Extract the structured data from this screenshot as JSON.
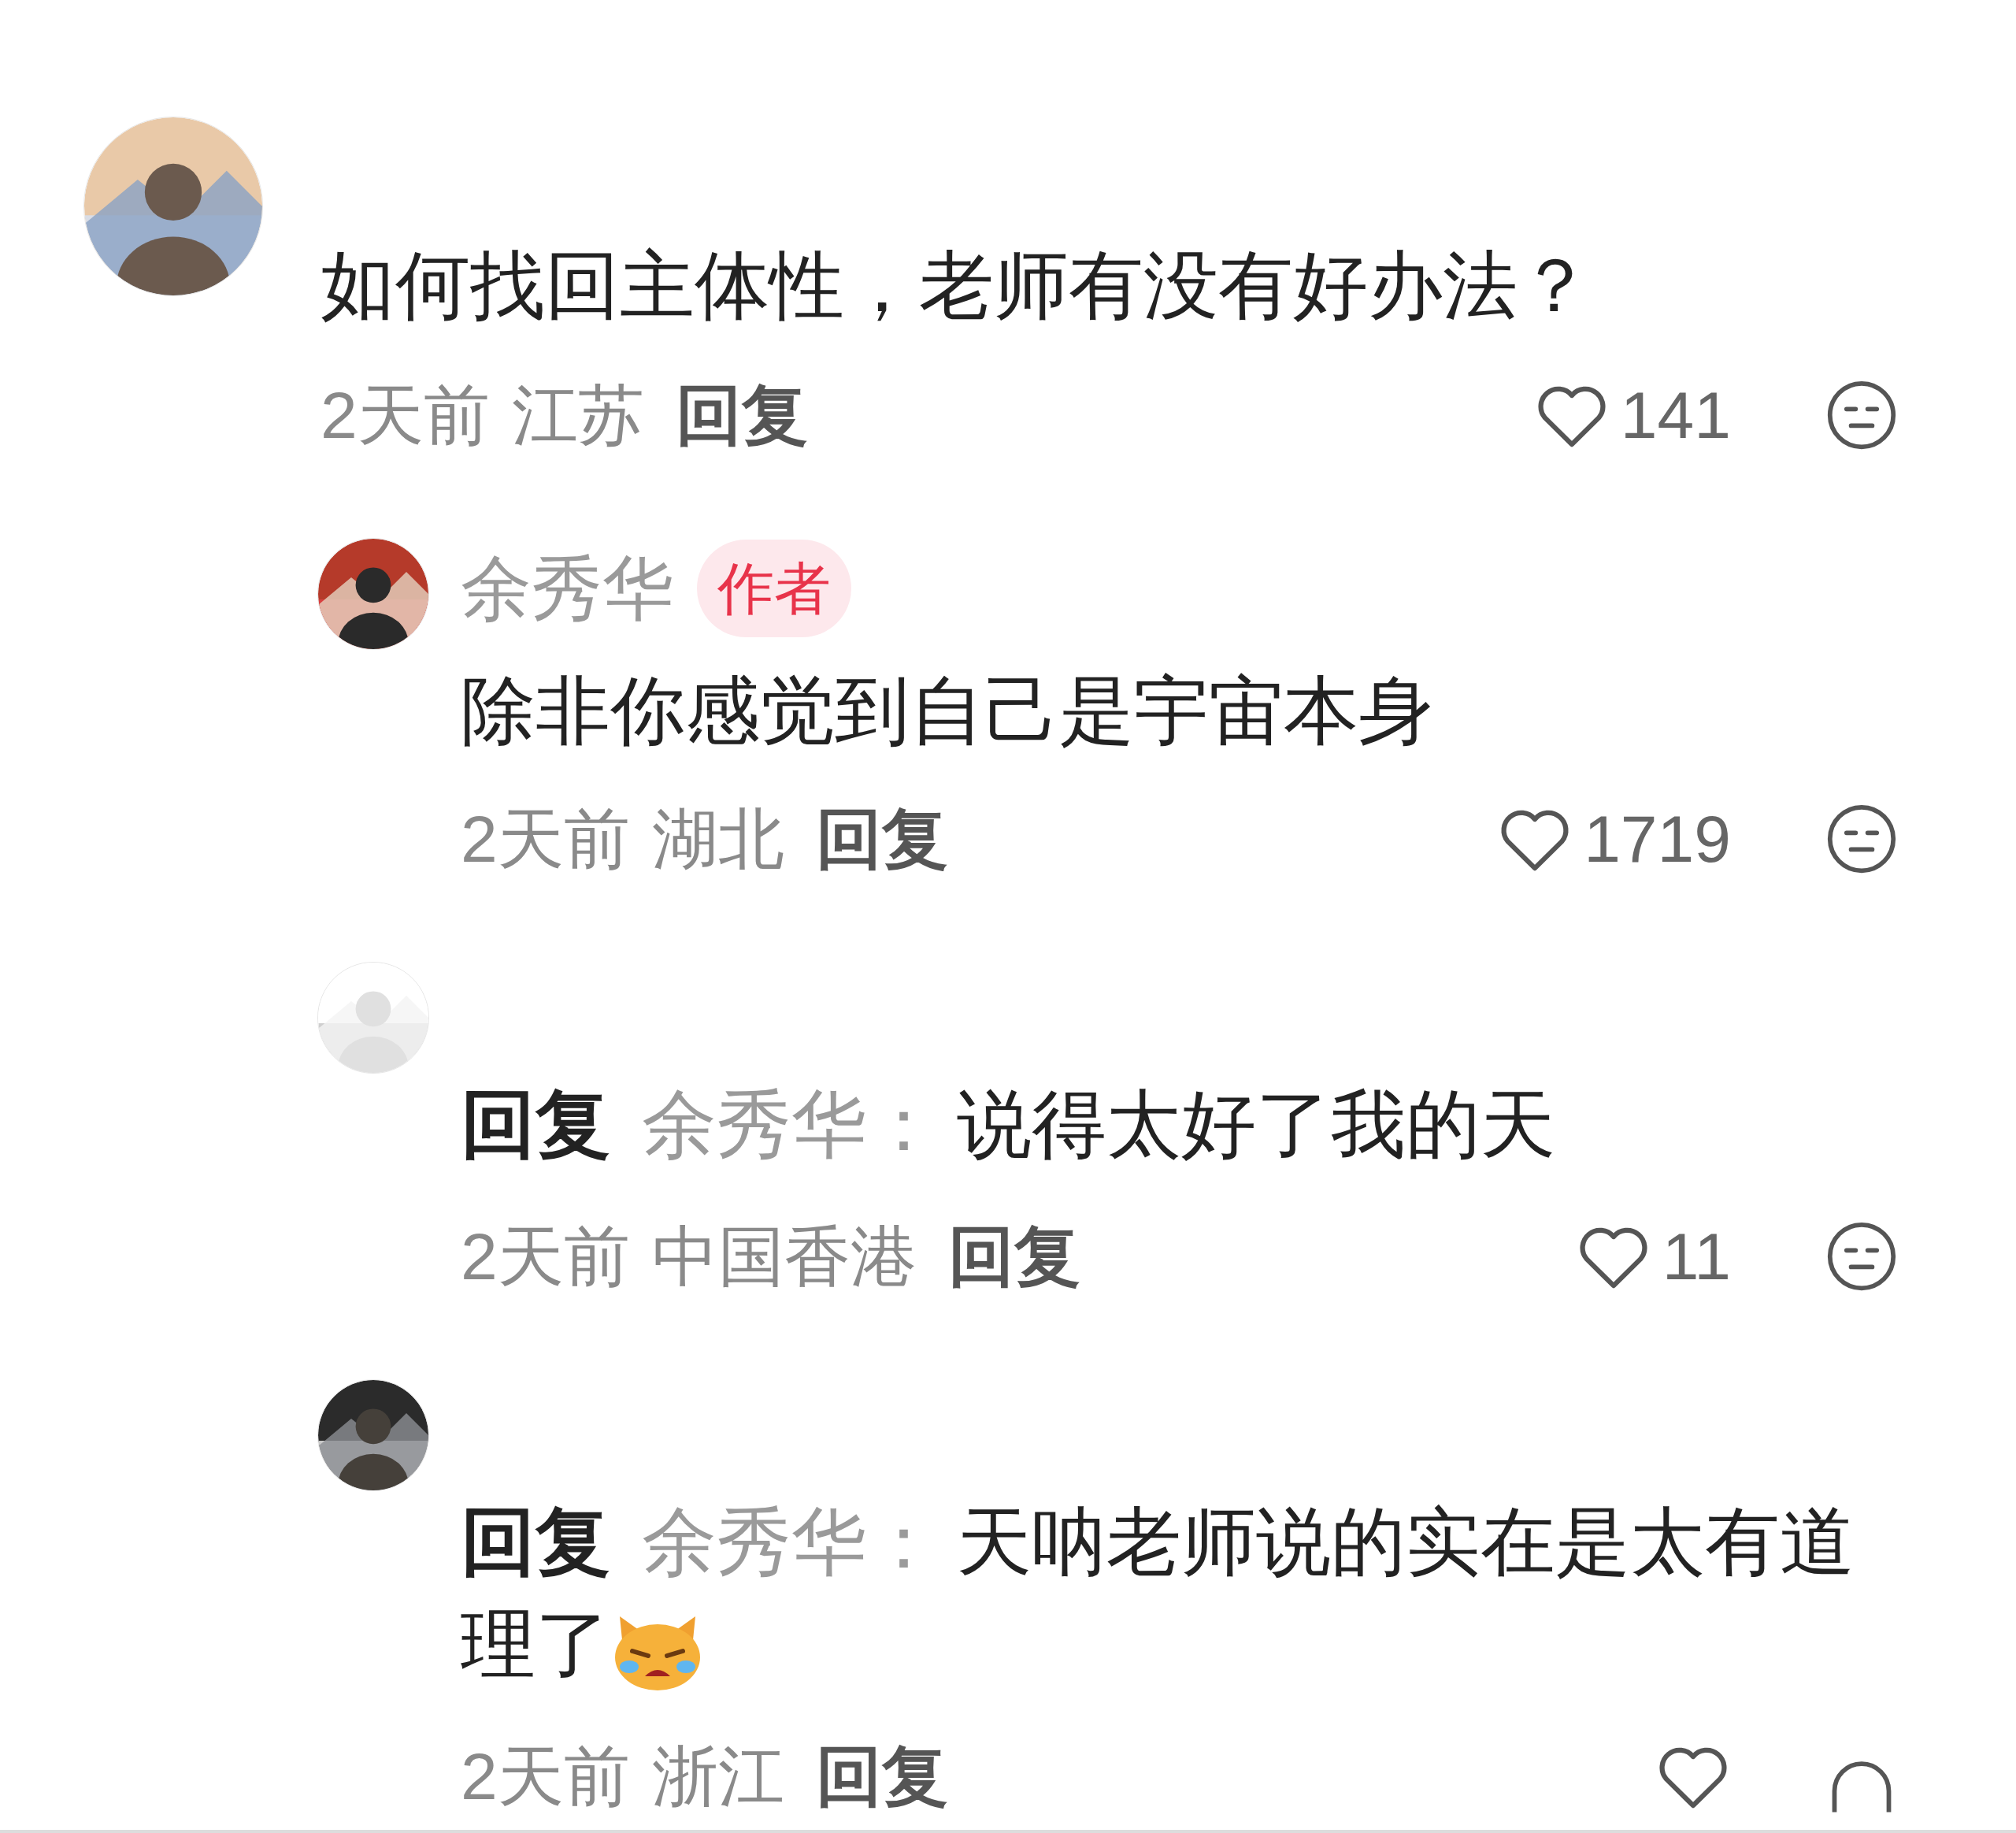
{
  "comments": [
    {
      "kind": "top",
      "text": "如何找回主体性，老师有没有好办法？",
      "time": "2天前",
      "location": "江苏",
      "reply_label": "回复",
      "likes": "141",
      "obscured": false
    },
    {
      "kind": "author",
      "name": "余秀华",
      "badge": "作者",
      "text": "除非你感觉到自己是宇宙本身",
      "time": "2天前",
      "location": "湖北",
      "reply_label": "回复",
      "likes": "1719",
      "obscured": false
    },
    {
      "kind": "reply",
      "reply_prefix": "回复",
      "reply_to": "余秀华：",
      "text": "说得太好了我的天",
      "time": "2天前",
      "location": "中国香港",
      "reply_label": "回复",
      "likes": "11",
      "obscured": false
    },
    {
      "kind": "reply",
      "reply_prefix": "回复",
      "reply_to": "余秀华：",
      "text": "天呐老师说的实在是太有道理了",
      "trailing_emoji": true,
      "time": "2天前",
      "location": "浙江",
      "reply_label": "回复",
      "obscured": true
    }
  ]
}
